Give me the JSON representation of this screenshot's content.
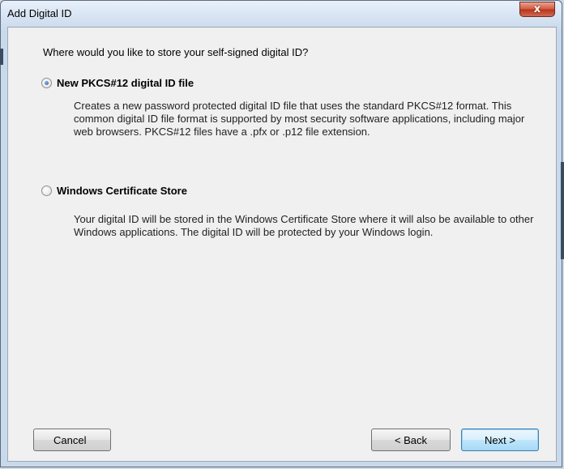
{
  "window": {
    "title": "Add Digital ID",
    "close_glyph": "x"
  },
  "question": "Where would you like to store your self-signed digital ID?",
  "options": [
    {
      "label": "New PKCS#12 digital ID file",
      "selected": true,
      "description": "Creates a new password protected digital ID file that uses the standard PKCS#12 format. This common digital ID file format is supported by most security software applications, including major web browsers. PKCS#12 files have a .pfx or .p12 file extension."
    },
    {
      "label": "Windows Certificate Store",
      "selected": false,
      "description": "Your digital ID will be stored in the Windows Certificate Store where it will also be available to other Windows applications. The digital ID will be protected by your Windows login."
    }
  ],
  "buttons": {
    "cancel": "Cancel",
    "back": "< Back",
    "next": "Next >"
  },
  "colors": {
    "accent": "#1b5aa7",
    "close": "#c74a32",
    "background": "#f0f0f0"
  }
}
